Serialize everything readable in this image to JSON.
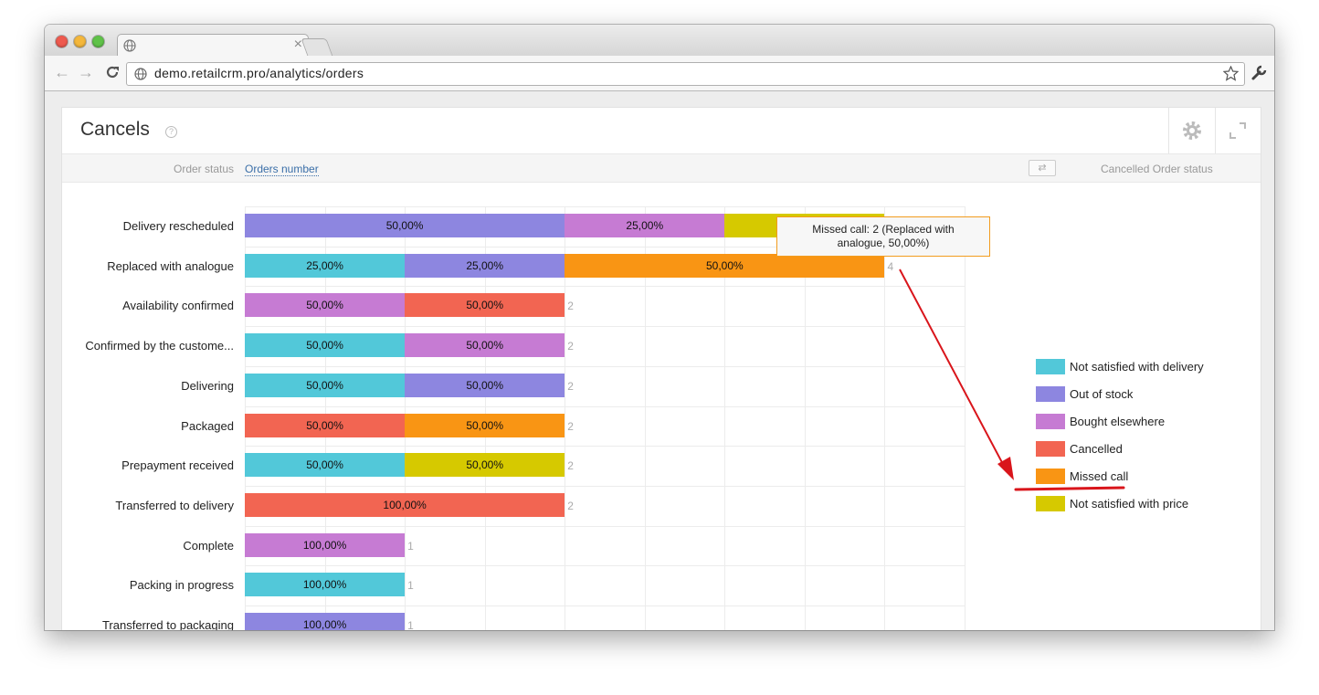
{
  "browser": {
    "url": "demo.retailcrm.pro/analytics/orders",
    "tab_close": "×"
  },
  "page": {
    "title": "Cancels",
    "help_mark": "?",
    "filters": {
      "order_status_label": "Order status",
      "orders_number_link": "Orders number",
      "cancelled_status_label": "Cancelled Order status"
    }
  },
  "chart_data": {
    "type": "bar",
    "orientation": "horizontal-stacked",
    "categories": [
      "Delivery rescheduled",
      "Replaced with analogue",
      "Availability confirmed",
      "Confirmed by the custome...",
      "Delivering",
      "Packaged",
      "Prepayment received",
      "Transferred to delivery",
      "Complete",
      "Packing in progress",
      "Transferred to packaging"
    ],
    "series": [
      {
        "name": "Not satisfied with delivery",
        "color": "#52c8d9"
      },
      {
        "name": "Out of stock",
        "color": "#8d86e0"
      },
      {
        "name": "Bought elsewhere",
        "color": "#c67bd3"
      },
      {
        "name": "Cancelled",
        "color": "#f26552"
      },
      {
        "name": "Missed call",
        "color": "#f99514"
      },
      {
        "name": "Not satisfied with price",
        "color": "#d6c900"
      }
    ],
    "rows": [
      {
        "segments": [
          {
            "series": 1,
            "value": 2,
            "label": "50,00%"
          },
          {
            "series": 2,
            "value": 1,
            "label": "25,00%"
          },
          {
            "series": 5,
            "value": 1,
            "label": "25,00%"
          }
        ],
        "total": ""
      },
      {
        "segments": [
          {
            "series": 0,
            "value": 1,
            "label": "25,00%"
          },
          {
            "series": 1,
            "value": 1,
            "label": "25,00%"
          },
          {
            "series": 4,
            "value": 2,
            "label": "50,00%"
          }
        ],
        "total": "4"
      },
      {
        "segments": [
          {
            "series": 2,
            "value": 1,
            "label": "50,00%"
          },
          {
            "series": 3,
            "value": 1,
            "label": "50,00%"
          }
        ],
        "total": "2"
      },
      {
        "segments": [
          {
            "series": 0,
            "value": 1,
            "label": "50,00%"
          },
          {
            "series": 2,
            "value": 1,
            "label": "50,00%"
          }
        ],
        "total": "2"
      },
      {
        "segments": [
          {
            "series": 0,
            "value": 1,
            "label": "50,00%"
          },
          {
            "series": 1,
            "value": 1,
            "label": "50,00%"
          }
        ],
        "total": "2"
      },
      {
        "segments": [
          {
            "series": 3,
            "value": 1,
            "label": "50,00%"
          },
          {
            "series": 4,
            "value": 1,
            "label": "50,00%"
          }
        ],
        "total": "2"
      },
      {
        "segments": [
          {
            "series": 0,
            "value": 1,
            "label": "50,00%"
          },
          {
            "series": 5,
            "value": 1,
            "label": "50,00%"
          }
        ],
        "total": "2"
      },
      {
        "segments": [
          {
            "series": 3,
            "value": 2,
            "label": "100,00%"
          }
        ],
        "total": "2"
      },
      {
        "segments": [
          {
            "series": 2,
            "value": 1,
            "label": "100,00%"
          }
        ],
        "total": "1"
      },
      {
        "segments": [
          {
            "series": 0,
            "value": 1,
            "label": "100,00%"
          }
        ],
        "total": "1"
      },
      {
        "segments": [
          {
            "series": 1,
            "value": 1,
            "label": "100,00%"
          }
        ],
        "total": "1"
      }
    ],
    "xlim": [
      0,
      4.5
    ],
    "grid": true,
    "legend_position": "right",
    "tooltip": {
      "line1": "Missed call: 2 (Replaced with",
      "line2": "analogue, 50,00%)"
    }
  },
  "annotation": {
    "arrow_color": "#d9151b",
    "highlighted_legend": "Missed call"
  }
}
